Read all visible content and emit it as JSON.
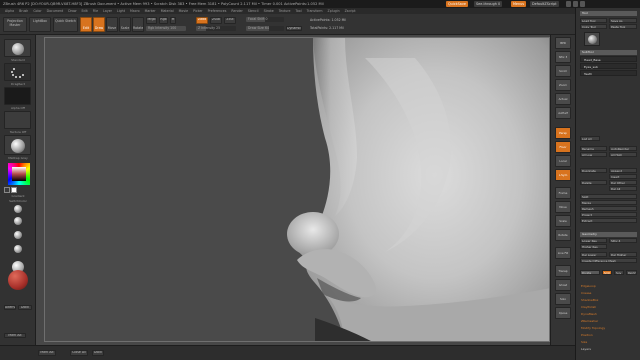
{
  "title_bar": {
    "text": "ZBrush 4R6 P2 [DO:YOUR-QB9R-VX8T-H8F3]   ZBrush Document   • Active Mem 993 • Scratch Disk 383 • Free Mem 3181 • PolyCount 2.117 Mil • Timer 0.001 ActivePoints:1.052 Mil",
    "quicksave": "QuickSave",
    "seethrough": "See-through 0",
    "menus": "Menus",
    "default_script": "DefaultZScript"
  },
  "menus": [
    "Alpha",
    "Brush",
    "Color",
    "Document",
    "Draw",
    "Edit",
    "File",
    "Layer",
    "Light",
    "Macro",
    "Marker",
    "Material",
    "Movie",
    "Picker",
    "Preferences",
    "Render",
    "Stencil",
    "Stroke",
    "Texture",
    "Tool",
    "Transform",
    "Zplugin",
    "Zscript"
  ],
  "top_shelf": {
    "projection_master": "Projection Master",
    "lightbox": "LightBox",
    "quick_sketch": "Quick Sketch",
    "edit": "Edit",
    "draw": "Draw",
    "move": "Move",
    "scale": "Scale",
    "rotate": "Rotate",
    "mrgb": "Mrgb",
    "rgb": "Rgb",
    "m": "M",
    "zadd": "Zadd",
    "zsub": "Zsub",
    "zcut": "Zcut",
    "focal_shift": "Focal Shift 0",
    "draw_size": "Draw Size 64",
    "rgb_intensity": "Rgb Intensity 100",
    "z_intensity": "Z Intensity 25",
    "active_points": "ActivePoints: 1.052 Mil",
    "total_points": "TotalPoints: 2.117 Mil",
    "dynamic": "Dynamic"
  },
  "left_shelf": {
    "brush_label": "Standard",
    "stroke_label": "DragRect",
    "alpha_label": "Alpha Off",
    "texture_label": "Texture Off",
    "material_label": "MatCap Gray",
    "gradient": "Gradient",
    "switch_color": "SwitchColor",
    "alternate": "Alternate",
    "colors": [
      "#3a3a3a",
      "#ffffff"
    ]
  },
  "right_strip": {
    "buttons": [
      "BPR",
      "SPix 3",
      "Scroll",
      "Zoom",
      "Actual",
      "AAHalf",
      "Persp",
      "Floor",
      "Local",
      "L.Sym",
      "Frame",
      "Move",
      "Scale",
      "Rotate",
      "Line Fill PolyF",
      "Transp",
      "Ghost",
      "Solo",
      "Xpose"
    ]
  },
  "tray": {
    "hdr_tool": "Tool",
    "tool_items": [
      "Load Tool",
      "Save As",
      "Copy Tool",
      "Paste Tool",
      "Import",
      "Export",
      "Clone",
      "Make PolyMesh3D",
      "GoZ",
      "All",
      "Visible",
      "R"
    ],
    "hdr_subtool": "SubTool",
    "subtool_items": [
      "Head_Base",
      "Eyes_sub",
      "Teeth"
    ],
    "list_all": "List All",
    "rename": "Rename",
    "auto_reorder": "AutoReorder",
    "all_low": "All Low",
    "all_high": "All High",
    "duplicate": "Duplicate",
    "append": "Append",
    "insert": "Insert",
    "del_other": "Del Other",
    "delete": "Delete",
    "del_all": "Del All",
    "split": "Split",
    "merge": "Merge",
    "remesh": "Remesh",
    "project": "Project",
    "extract": "Extract",
    "hdr_geometry": "Geometry",
    "lower_res": "Lower Res",
    "higher_res": "Higher Res",
    "sdiv": "SDiv 4",
    "del_lower": "Del Lower",
    "del_higher": "Del Higher",
    "create_diff_mesh": "Create Difference Mesh",
    "divide": "Divide",
    "smt": "Smt",
    "suv": "Suv",
    "rel_uv": "ReUV",
    "geometry_items": [
      "EdgeLoop",
      "Crease",
      "ShadowBox",
      "ClayPolish",
      "DynaMesh",
      "ZRemesher",
      "Modify Topology",
      "Position",
      "Size",
      "MeshIntegrity"
    ],
    "footer": "Layers"
  },
  "bottom_bar": {
    "left": "Mark Alt",
    "mid_a": "Close All",
    "mid_b": "Dock"
  }
}
